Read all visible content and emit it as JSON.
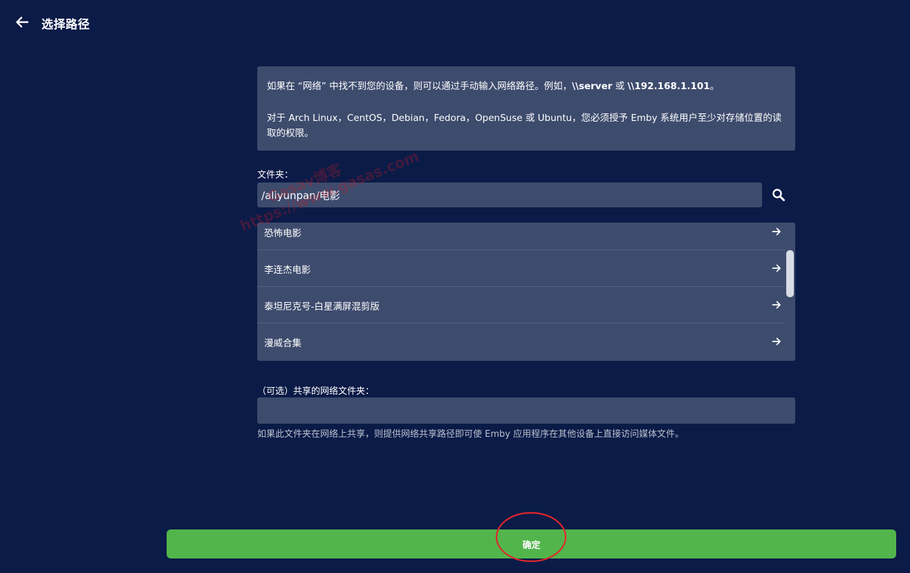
{
  "header": {
    "title": "选择路径"
  },
  "info": {
    "p1_prefix": "如果在 “网络” 中找不到您的设备，则可以通过手动输入网络路径。例如，",
    "p1_example1": "\\\\server",
    "p1_or": " 或 ",
    "p1_example2": "\\\\192.168.1.101",
    "p1_suffix": "。",
    "p2": "对于 Arch Linux，CentOS，Debian，Fedora，OpenSuse 或 Ubuntu，您必须授予 Emby 系统用户至少对存储位置的读取的权限。"
  },
  "folder": {
    "label": "文件夹：",
    "value": "/aliyunpan/电影"
  },
  "folder_list": {
    "items": [
      {
        "label": "恐怖电影"
      },
      {
        "label": "李连杰电影"
      },
      {
        "label": "泰坦尼克号-白星满屏混剪版"
      },
      {
        "label": "漫威合集"
      }
    ]
  },
  "share": {
    "label": "（可选）共享的网络文件夹：",
    "value": "",
    "help": "如果此文件夹在网络上共享，则提供网络共享路径即可使 Emby 应用程序在其他设备上直接访问媒体文件。"
  },
  "footer": {
    "confirm_label": "确定"
  },
  "watermark": {
    "line1": "Gasav博客",
    "line2": "https://www.gasas.com"
  },
  "colors": {
    "background": "#0b1b47",
    "panel": "#3d4b6d",
    "confirm": "#52b54b",
    "annotation": "#e0262b"
  }
}
